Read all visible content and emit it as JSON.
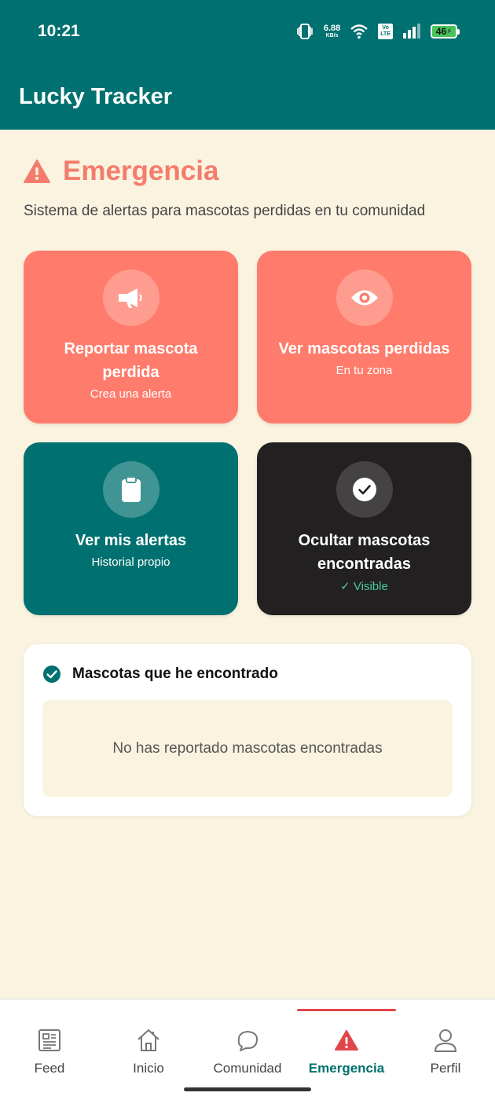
{
  "status_bar": {
    "time": "10:21",
    "speed_value": "6.88",
    "speed_unit": "KB/s",
    "volte_line1": "Vo",
    "volte_line2": "LTE",
    "battery": "46"
  },
  "app_bar": {
    "title": "Lucky Tracker"
  },
  "header": {
    "title": "Emergencia",
    "subtitle": "Sistema de alertas para mascotas perdidas en tu comunidad"
  },
  "cards": [
    {
      "title": "Reportar mascota perdida",
      "subtitle": "Crea una alerta",
      "icon": "megaphone-icon"
    },
    {
      "title": "Ver mascotas perdidas",
      "subtitle": "En tu zona",
      "icon": "eye-icon"
    },
    {
      "title": "Ver mis alertas",
      "subtitle": "Historial propio",
      "icon": "clipboard-icon"
    },
    {
      "title": "Ocultar mascotas encontradas",
      "subtitle": "✓ Visible",
      "icon": "check-icon"
    }
  ],
  "found_section": {
    "title": "Mascotas que he encontrado",
    "empty_text": "No has reportado mascotas encontradas"
  },
  "bottom_nav": [
    {
      "label": "Feed",
      "icon": "newspaper-icon"
    },
    {
      "label": "Inicio",
      "icon": "home-icon"
    },
    {
      "label": "Comunidad",
      "icon": "chat-icon"
    },
    {
      "label": "Emergencia",
      "icon": "warning-icon",
      "active": true
    },
    {
      "label": "Perfil",
      "icon": "person-icon"
    }
  ],
  "colors": {
    "primary": "#007070",
    "coral": "#FF7B6B",
    "alert_red": "#E0454A",
    "background": "#FAF3E0",
    "dark_card": "#222020"
  }
}
